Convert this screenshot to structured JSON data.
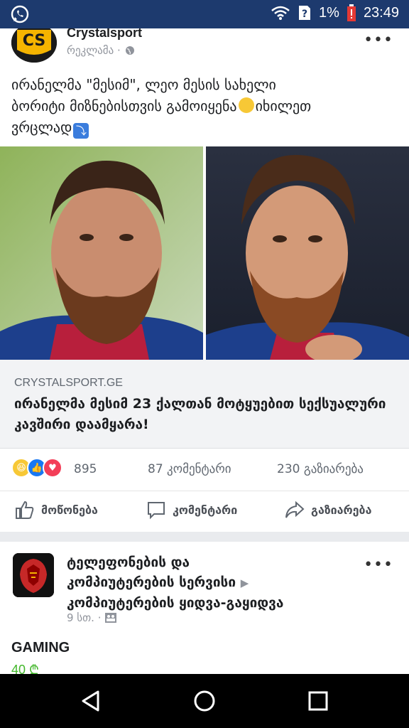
{
  "status_bar": {
    "battery_percent": "1%",
    "time": "23:49",
    "icons": [
      "whatsapp-icon",
      "wifi-icon",
      "sim-unknown-icon",
      "battery-low-icon"
    ]
  },
  "post": {
    "page_name": "Crystalsport",
    "sponsored_label": "რეკლამა ·",
    "caption_line1": "ირანელმა \"მესიმ\", ლეო მესის სახელი",
    "caption_line2_a": "ბორიტი მიზნებისთვის გამოიყენა",
    "caption_line2_b": "იხილეთ",
    "caption_line3": "ვრცლად",
    "link_domain": "CRYSTALSPORT.GE",
    "link_title": "ირანელმა მესიმ 23 ქალთან მოტყუებით სექსუალური კავშირი დაამყარა!",
    "reactions_count": "895",
    "comments_count": "87 კომენტარი",
    "shares_count": "230 გაზიარება",
    "actions": {
      "like": "მოწონება",
      "comment": "კომენტარი",
      "share": "გაზიარება"
    }
  },
  "post2": {
    "title_line1": "ტელეფონების და",
    "title_line2": "კომპიუტერების სერვისი",
    "title_line3": "კომპიუტერების ყიდვა-გაყიდვა",
    "meta": "9 სთ. ·",
    "item_title": "GAMING",
    "price": "40 ₾"
  },
  "colors": {
    "status_bar": "#1d3a6e",
    "link_bg": "#f2f3f5",
    "like_blue": "#1877f2",
    "price_green": "#42b72a"
  }
}
